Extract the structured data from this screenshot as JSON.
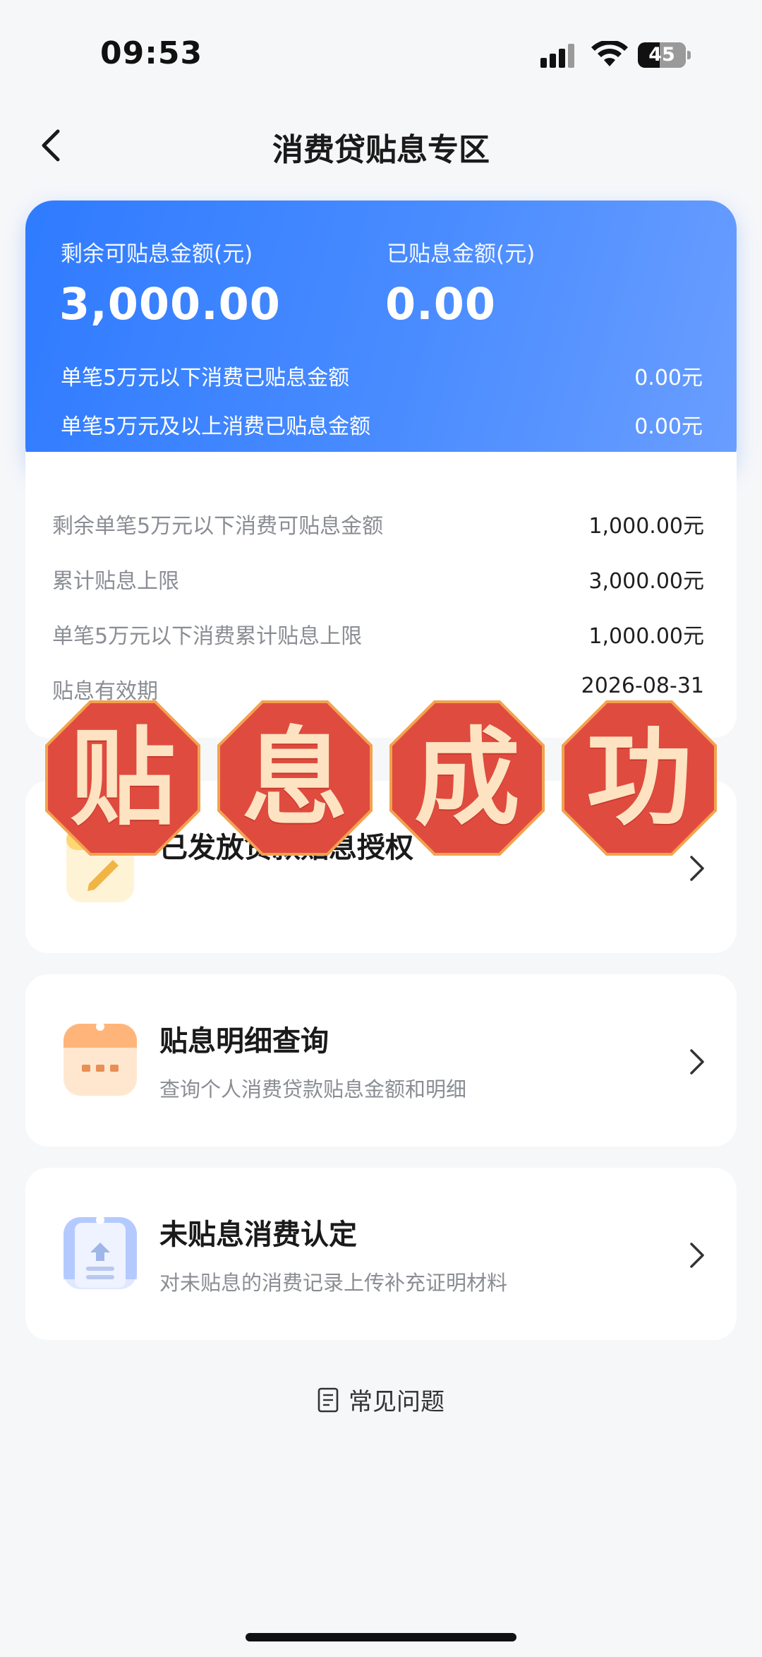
{
  "status_bar": {
    "time": "09:53",
    "battery": "45",
    "battery_level": 0.45
  },
  "nav": {
    "title": "消费贷贴息专区"
  },
  "summary": {
    "remaining_label": "剩余可贴息金额(元)",
    "remaining_value": "3,000.00",
    "paid_label": "已贴息金额(元)",
    "paid_value": "0.00",
    "rows": [
      {
        "label": "单笔5万元以下消费已贴息金额",
        "value": "0.00元"
      },
      {
        "label": "单笔5万元及以上消费已贴息金额",
        "value": "0.00元"
      }
    ]
  },
  "details": {
    "rows": [
      {
        "label": "剩余单笔5万元以下消费可贴息金额",
        "value": "1,000.00元"
      },
      {
        "label": "累计贴息上限",
        "value": "3,000.00元"
      },
      {
        "label": "单笔5万元以下消费累计贴息上限",
        "value": "1,000.00元"
      },
      {
        "label": "贴息有效期",
        "value": "2026-08-31"
      }
    ]
  },
  "entries": [
    {
      "title": "已发放贷款贴息授权",
      "subtitle": "",
      "icon": "pencil-document-icon"
    },
    {
      "title": "贴息明细查询",
      "subtitle": "查询个人消费贷款贴息金额和明细",
      "icon": "receipt-icon"
    },
    {
      "title": "未贴息消费认定",
      "subtitle": "对未贴息的消费记录上传补充证明材料",
      "icon": "upload-document-icon"
    }
  ],
  "faq": {
    "label": "常见问题"
  },
  "stamps": [
    "贴",
    "息",
    "成",
    "功"
  ],
  "colors": {
    "accent": "#2f7bff",
    "stamp_red": "#e04b3f",
    "stamp_text": "#fde3c2"
  }
}
